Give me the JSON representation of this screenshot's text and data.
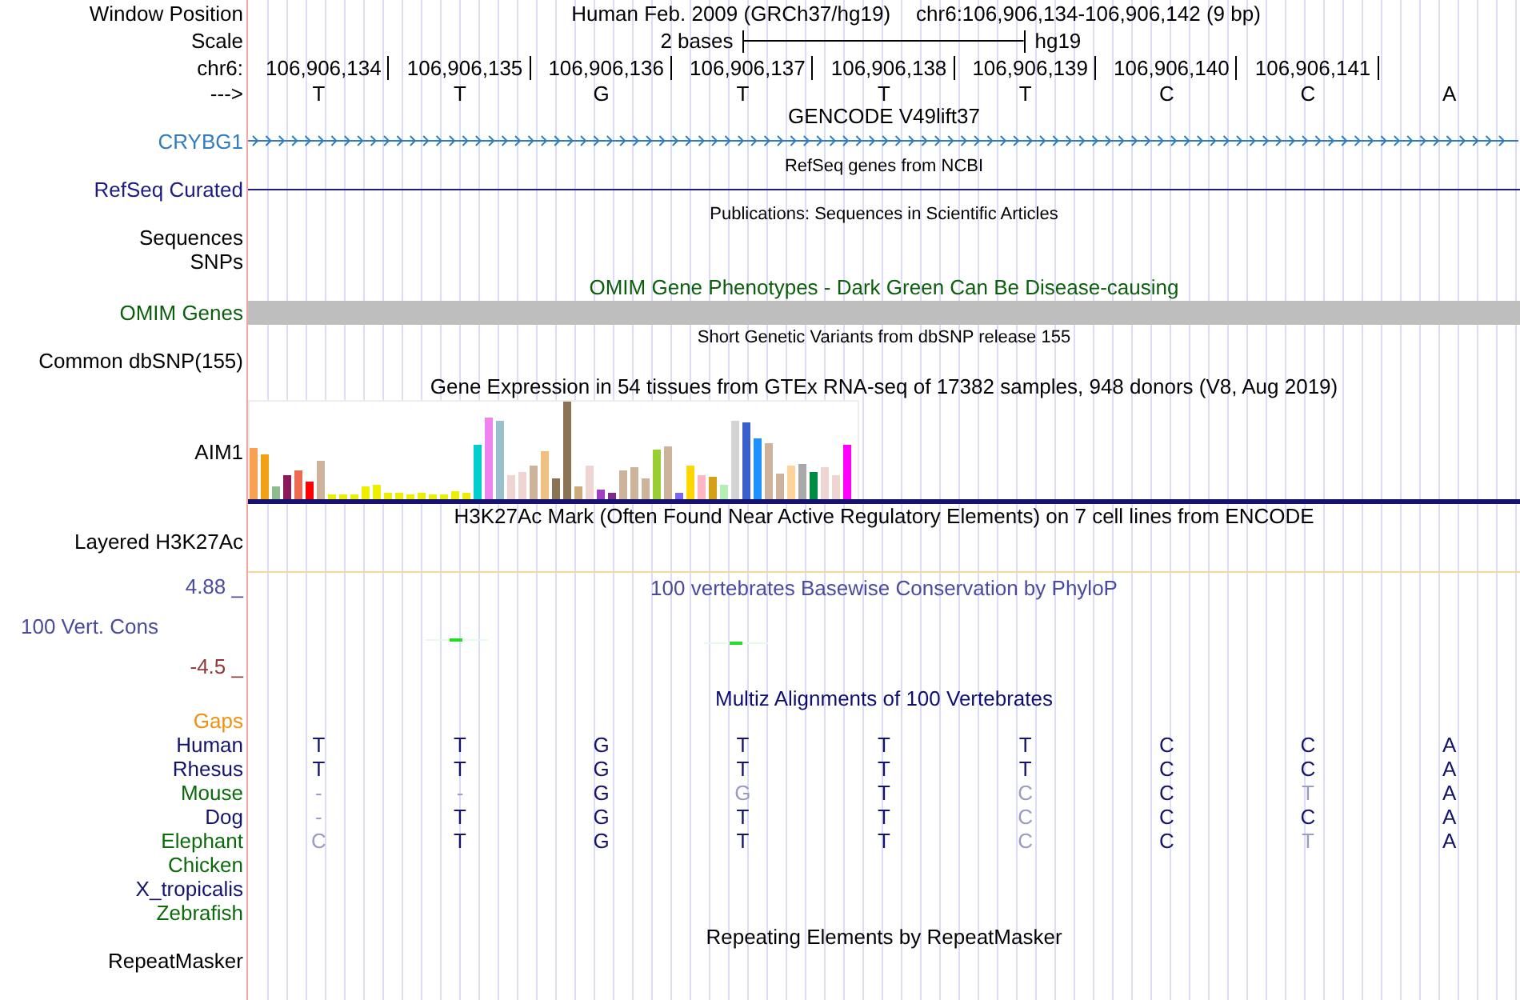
{
  "header": {
    "label": "Window Position",
    "assembly": "Human Feb. 2009 (GRCh37/hg19)",
    "position": "chr6:106,906,134-106,906,142 (9 bp)"
  },
  "scale": {
    "label": "Scale",
    "span": "2 bases",
    "assembly": "hg19"
  },
  "ruler": {
    "label": "chr6:",
    "positions": [
      "106,906,134",
      "106,906,135",
      "106,906,136",
      "106,906,137",
      "106,906,138",
      "106,906,139",
      "106,906,140",
      "106,906,141"
    ]
  },
  "sequence": {
    "label": "--->",
    "bases": [
      "T",
      "T",
      "G",
      "T",
      "T",
      "T",
      "C",
      "C",
      "A"
    ]
  },
  "tracks": [
    {
      "kind": "gene",
      "title": "GENCODE V49lift37",
      "labels": [
        "CRYBG1"
      ],
      "color": "#2f7cc0"
    },
    {
      "kind": "line",
      "title": "RefSeq genes from NCBI",
      "labels": [
        "RefSeq Curated"
      ],
      "color": "#1c1c80"
    },
    {
      "kind": "empty",
      "title": "Publications: Sequences in Scientific Articles",
      "labels": [
        "Sequences",
        "SNPs"
      ],
      "color": "#000000"
    },
    {
      "kind": "bar",
      "title": "OMIM Gene Phenotypes - Dark Green Can Be Disease-causing",
      "labels": [
        "OMIM Genes"
      ],
      "color": "#0b5e0b"
    },
    {
      "kind": "empty",
      "title": "Short Genetic Variants from dbSNP release 155",
      "labels": [
        "Common dbSNP(155)"
      ],
      "color": "#000000"
    },
    {
      "kind": "expression",
      "title": "Gene Expression in 54 tissues from GTEx RNA-seq of 17382 samples, 948 donors (V8, Aug 2019)",
      "labels": [
        "AIM1"
      ],
      "color": "#000000"
    },
    {
      "kind": "empty",
      "title": "H3K27Ac Mark (Often Found Near Active Regulatory Elements) on 7 cell lines from ENCODE",
      "labels": [
        "Layered H3K27Ac"
      ],
      "color": "#000000"
    },
    {
      "kind": "wiggle",
      "title": "100 vertebrates Basewise Conservation by PhyloP",
      "labels": [
        "100 Vert. Cons"
      ],
      "max": "4.88 _",
      "min": "-4.5 _",
      "color": "#4a4aa0"
    },
    {
      "kind": "alignment",
      "title": "Multiz Alignments of 100 Vertebrates",
      "labels": [
        "Gaps"
      ],
      "color": "#0e0e70",
      "species": [
        {
          "name": "Human",
          "color": "#14146e",
          "bases": [
            {
              "base": "T",
              "faint": false
            },
            {
              "base": "T",
              "faint": false
            },
            {
              "base": "G",
              "faint": false
            },
            {
              "base": "T",
              "faint": false
            },
            {
              "base": "T",
              "faint": false
            },
            {
              "base": "T",
              "faint": false
            },
            {
              "base": "C",
              "faint": false
            },
            {
              "base": "C",
              "faint": false
            },
            {
              "base": "A",
              "faint": false
            }
          ]
        },
        {
          "name": "Rhesus",
          "color": "#14146e",
          "bases": [
            {
              "base": "T",
              "faint": false
            },
            {
              "base": "T",
              "faint": false
            },
            {
              "base": "G",
              "faint": false
            },
            {
              "base": "T",
              "faint": false
            },
            {
              "base": "T",
              "faint": false
            },
            {
              "base": "T",
              "faint": false
            },
            {
              "base": "C",
              "faint": false
            },
            {
              "base": "C",
              "faint": false
            },
            {
              "base": "A",
              "faint": false
            }
          ]
        },
        {
          "name": "Mouse",
          "color": "#0b6b0b",
          "bases": [
            {
              "base": "-",
              "faint": true
            },
            {
              "base": "-",
              "faint": true
            },
            {
              "base": "G",
              "faint": false
            },
            {
              "base": "G",
              "faint": true
            },
            {
              "base": "T",
              "faint": false
            },
            {
              "base": "C",
              "faint": true
            },
            {
              "base": "C",
              "faint": false
            },
            {
              "base": "T",
              "faint": true
            },
            {
              "base": "A",
              "faint": false
            }
          ]
        },
        {
          "name": "Dog",
          "color": "#14146e",
          "bases": [
            {
              "base": "-",
              "faint": true
            },
            {
              "base": "T",
              "faint": false
            },
            {
              "base": "G",
              "faint": false
            },
            {
              "base": "T",
              "faint": false
            },
            {
              "base": "T",
              "faint": false
            },
            {
              "base": "C",
              "faint": true
            },
            {
              "base": "C",
              "faint": false
            },
            {
              "base": "C",
              "faint": false
            },
            {
              "base": "A",
              "faint": false
            }
          ]
        },
        {
          "name": "Elephant",
          "color": "#0b6b0b",
          "bases": [
            {
              "base": "C",
              "faint": true
            },
            {
              "base": "T",
              "faint": false
            },
            {
              "base": "G",
              "faint": false
            },
            {
              "base": "T",
              "faint": false
            },
            {
              "base": "T",
              "faint": false
            },
            {
              "base": "C",
              "faint": true
            },
            {
              "base": "C",
              "faint": false
            },
            {
              "base": "T",
              "faint": true
            },
            {
              "base": "A",
              "faint": false
            }
          ]
        },
        {
          "name": "Chicken",
          "color": "#0b6b0b"
        },
        {
          "name": "X_tropicalis",
          "color": "#14146e"
        },
        {
          "name": "Zebrafish",
          "color": "#0b6b0b"
        }
      ]
    },
    {
      "kind": "empty",
      "title": "Repeating Elements by RepeatMasker",
      "labels": [
        "RepeatMasker"
      ],
      "color": "#000000"
    }
  ]
}
